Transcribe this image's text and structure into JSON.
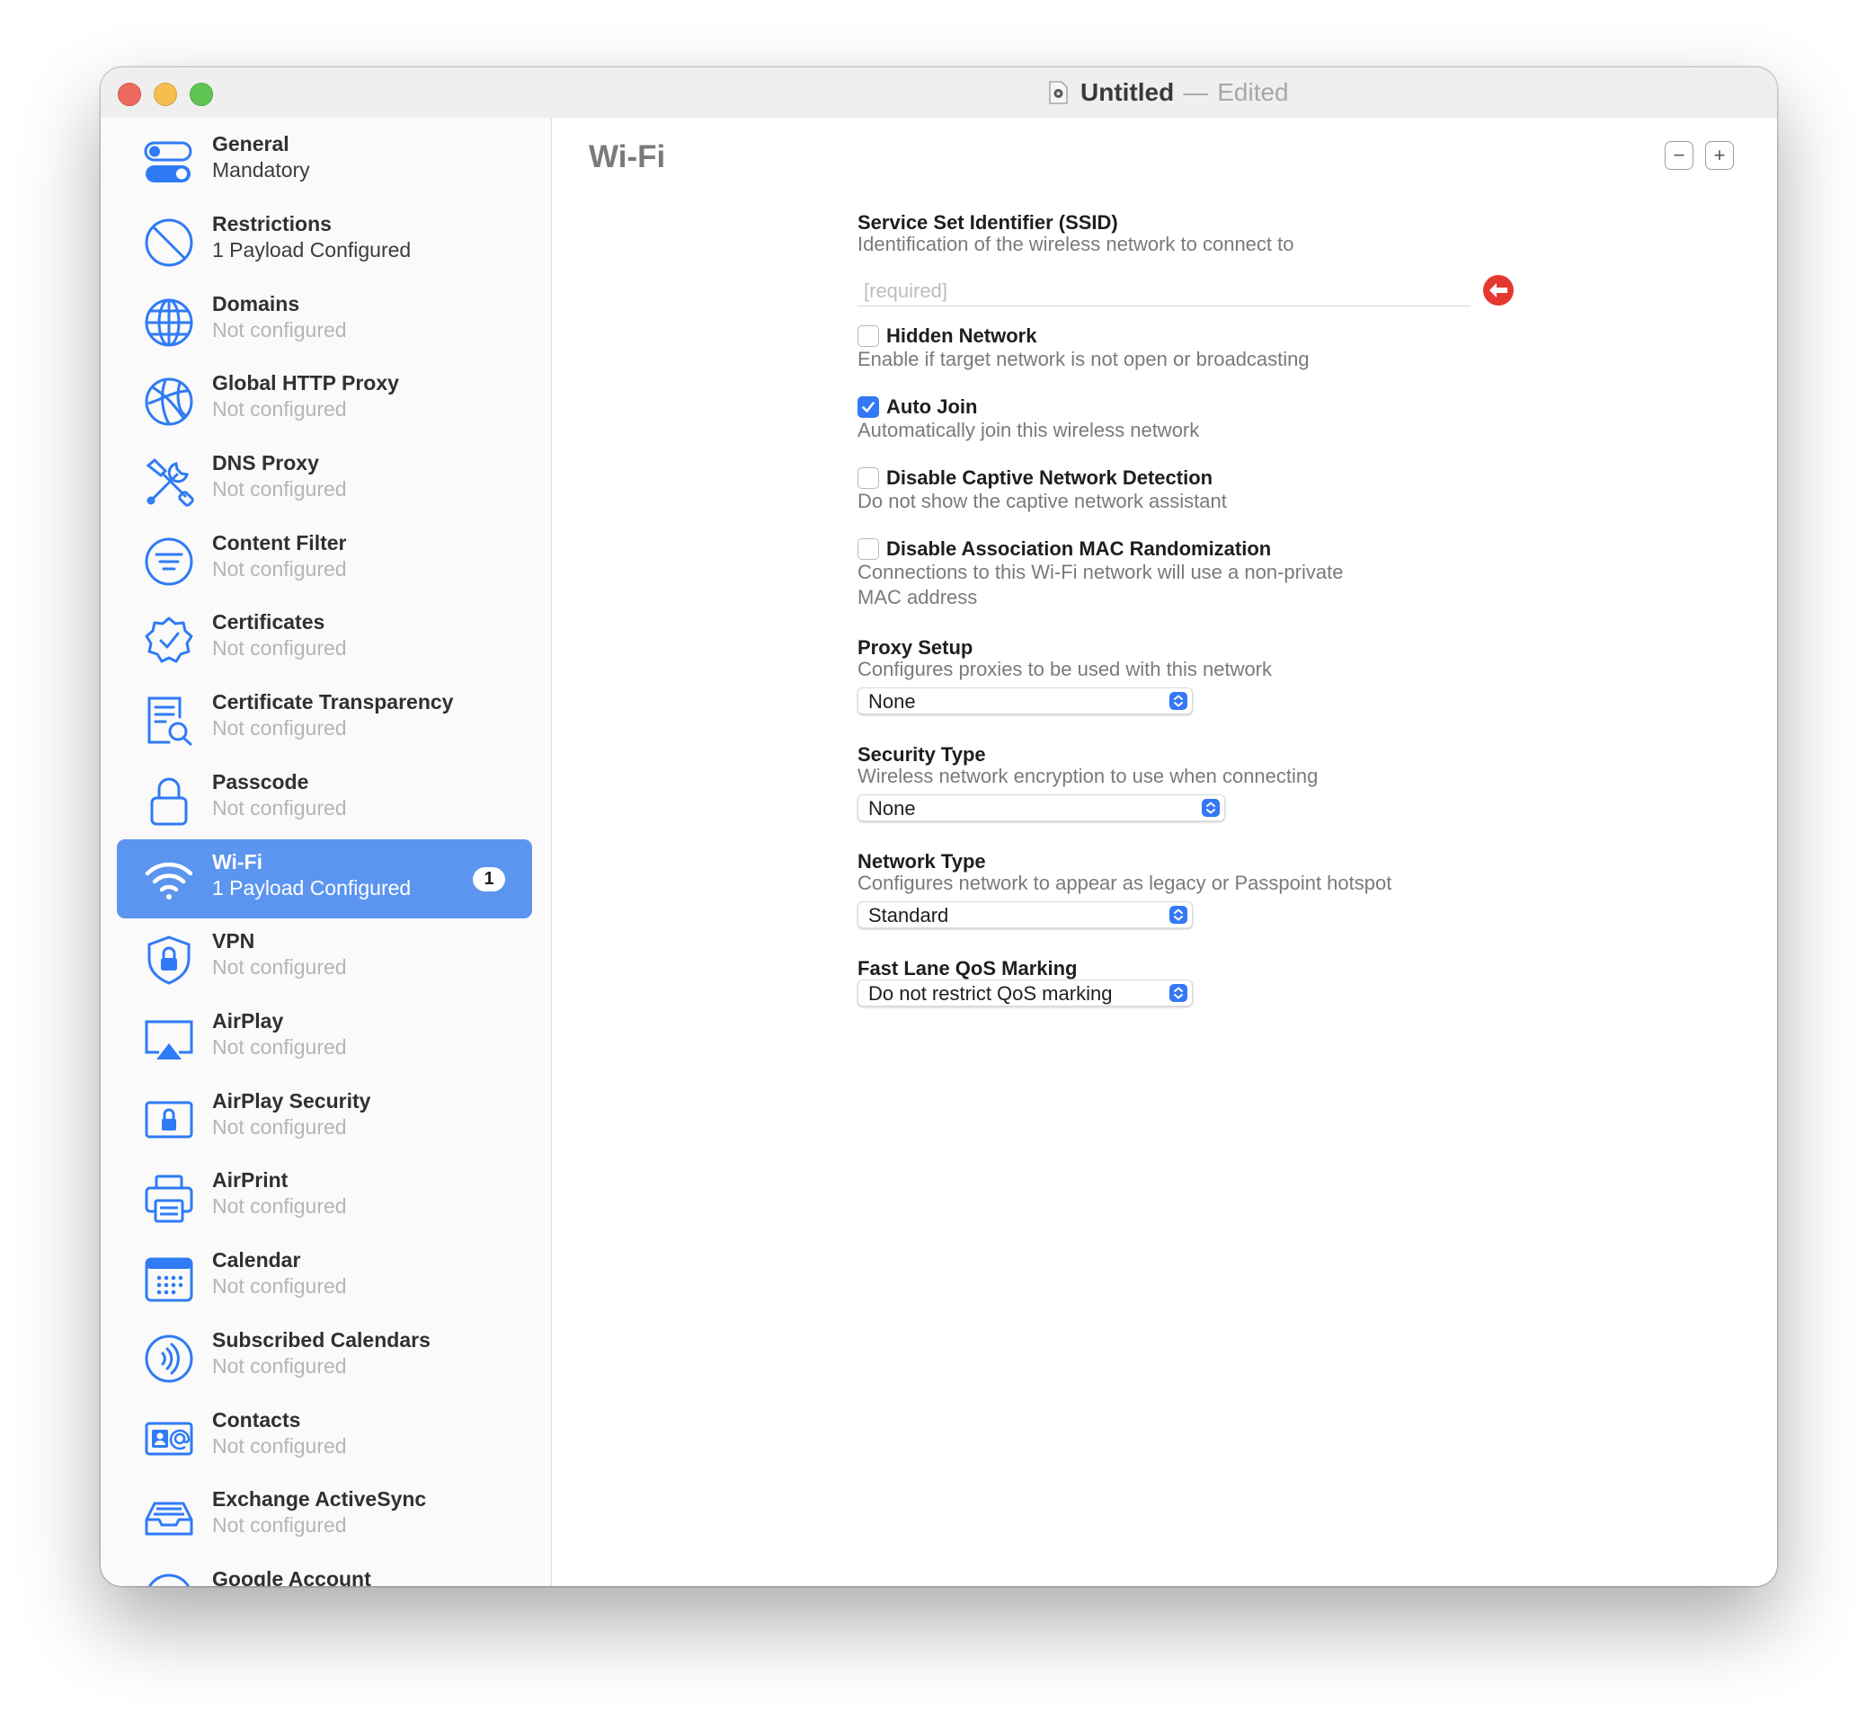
{
  "window": {
    "document_name": "Untitled",
    "separator": "—",
    "edited_label": "Edited"
  },
  "sidebar": {
    "items": [
      {
        "title": "General",
        "subtitle": "Mandatory",
        "icon": "toggle-switches-icon"
      },
      {
        "title": "Restrictions",
        "subtitle": "1 Payload Configured",
        "icon": "prohibited-icon"
      },
      {
        "title": "Domains",
        "subtitle": "Not configured",
        "icon": "globe-icon"
      },
      {
        "title": "Global HTTP Proxy",
        "subtitle": "Not configured",
        "icon": "globe-network-icon"
      },
      {
        "title": "DNS Proxy",
        "subtitle": "Not configured",
        "icon": "tools-icon"
      },
      {
        "title": "Content Filter",
        "subtitle": "Not configured",
        "icon": "filter-icon"
      },
      {
        "title": "Certificates",
        "subtitle": "Not configured",
        "icon": "certificate-badge-icon"
      },
      {
        "title": "Certificate Transparency",
        "subtitle": "Not configured",
        "icon": "document-magnifier-icon"
      },
      {
        "title": "Passcode",
        "subtitle": "Not configured",
        "icon": "lock-icon"
      },
      {
        "title": "Wi-Fi",
        "subtitle": "1 Payload Configured",
        "icon": "wifi-icon",
        "badge": "1"
      },
      {
        "title": "VPN",
        "subtitle": "Not configured",
        "icon": "shield-lock-icon"
      },
      {
        "title": "AirPlay",
        "subtitle": "Not configured",
        "icon": "airplay-icon"
      },
      {
        "title": "AirPlay Security",
        "subtitle": "Not configured",
        "icon": "airplay-lock-icon"
      },
      {
        "title": "AirPrint",
        "subtitle": "Not configured",
        "icon": "printer-icon"
      },
      {
        "title": "Calendar",
        "subtitle": "Not configured",
        "icon": "calendar-icon"
      },
      {
        "title": "Subscribed Calendars",
        "subtitle": "Not configured",
        "icon": "broadcast-icon"
      },
      {
        "title": "Contacts",
        "subtitle": "Not configured",
        "icon": "contact-card-icon"
      },
      {
        "title": "Exchange ActiveSync",
        "subtitle": "Not configured",
        "icon": "inbox-tray-icon"
      },
      {
        "title": "Google Account",
        "subtitle": "",
        "icon": "envelope-icon"
      }
    ]
  },
  "main": {
    "title": "Wi-Fi",
    "remove_label": "−",
    "add_label": "+",
    "ssid": {
      "label": "Service Set Identifier (SSID)",
      "description": "Identification of the wireless network to connect to",
      "value": "",
      "placeholder": "[required]"
    },
    "hidden_network": {
      "label": "Hidden Network",
      "description": "Enable if target network is not open or broadcasting",
      "checked": false
    },
    "auto_join": {
      "label": "Auto Join",
      "description": "Automatically join this wireless network",
      "checked": true
    },
    "captive": {
      "label": "Disable Captive Network Detection",
      "description": "Do not show the captive network assistant",
      "checked": false
    },
    "mac_random": {
      "label": "Disable Association MAC Randomization",
      "description_line1": "Connections to this Wi-Fi network will use a non-private",
      "description_line2": "MAC address",
      "checked": false
    },
    "proxy": {
      "label": "Proxy Setup",
      "description": "Configures proxies to be used with this network",
      "value": "None"
    },
    "security": {
      "label": "Security Type",
      "description": "Wireless network encryption to use when connecting",
      "value": "None"
    },
    "network_type": {
      "label": "Network Type",
      "description": "Configures network to appear as legacy or Passpoint hotspot",
      "value": "Standard"
    },
    "qos": {
      "label": "Fast Lane QoS Marking",
      "value": "Do not restrict QoS marking"
    }
  },
  "colors": {
    "accent": "#3478f6",
    "selection": "#5b95f0",
    "icon_blue": "#2f7bf5",
    "error_red": "#e5382f"
  }
}
